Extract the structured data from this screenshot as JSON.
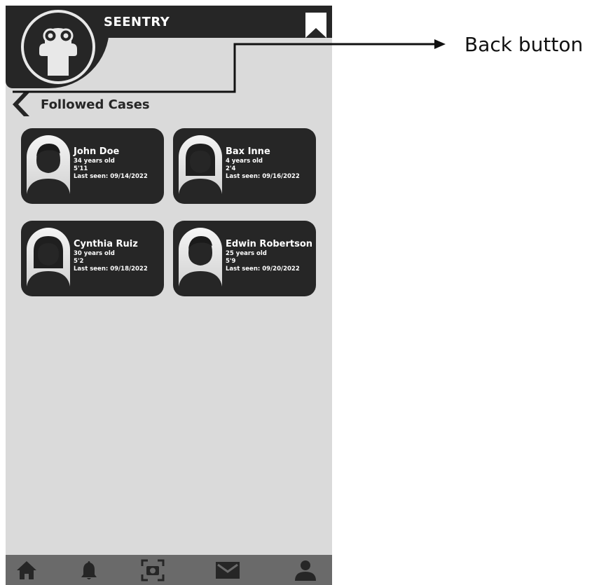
{
  "app": {
    "title": "SEENTRY",
    "logo_icon": "binoculars-person-icon",
    "bookmark_icon": "bookmark-icon"
  },
  "page": {
    "title": "Followed Cases",
    "back_icon": "chevron-left-icon"
  },
  "cases": [
    {
      "name": "John Doe",
      "age": "34 years old",
      "height": "5'11",
      "last_seen": "Last seen: 09/14/2022",
      "avatar": "male"
    },
    {
      "name": "Bax Inne",
      "age": "4 years old",
      "height": "2'4",
      "last_seen": "Last seen: 09/16/2022",
      "avatar": "female"
    },
    {
      "name": "Cynthia Ruiz",
      "age": "30 years old",
      "height": "5'2",
      "last_seen": "Last seen: 09/18/2022",
      "avatar": "female"
    },
    {
      "name": "Edwin Robertson",
      "age": "25 years old",
      "height": "5'9",
      "last_seen": "Last seen: 09/20/2022",
      "avatar": "male"
    }
  ],
  "nav": [
    {
      "icon": "home-icon"
    },
    {
      "icon": "bell-icon"
    },
    {
      "icon": "camera-scan-icon"
    },
    {
      "icon": "mail-icon"
    },
    {
      "icon": "user-icon"
    }
  ],
  "annotation": {
    "label": "Back button"
  },
  "colors": {
    "dark": "#262626",
    "background": "#dadada",
    "nav": "#6a6a6a"
  }
}
